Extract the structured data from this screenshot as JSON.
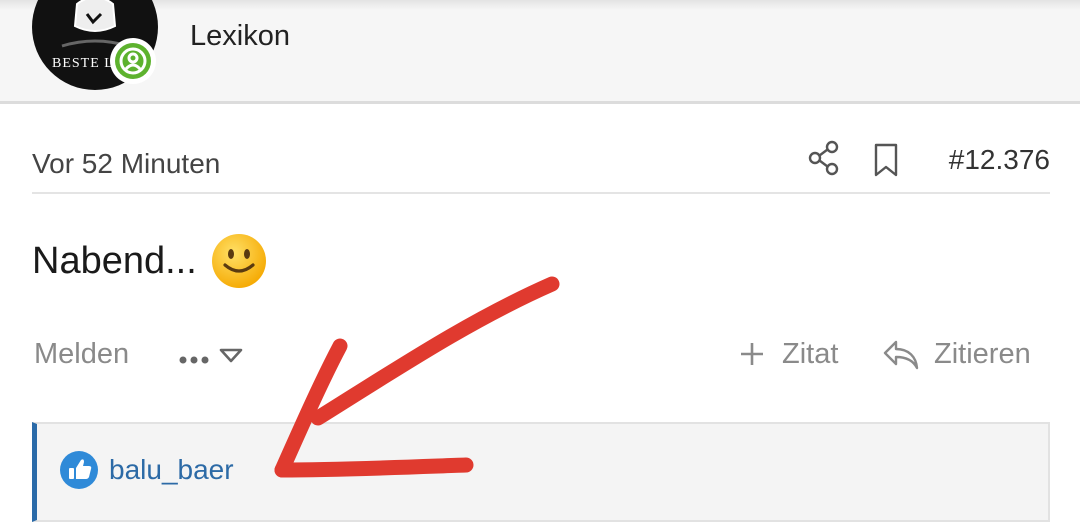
{
  "header": {
    "avatar_caption": "BESTE L",
    "section_label": "Lexikon"
  },
  "post": {
    "time": "Vor 52 Minuten",
    "post_number": "#12.376",
    "text": "Nabend...",
    "emoji": "slightly-smiling-face"
  },
  "actions": {
    "report_label": "Melden",
    "quote_label": "Zitat",
    "reply_label": "Zitieren"
  },
  "reactions": {
    "icon": "thumbs-up-icon",
    "user": "balu_baer"
  },
  "colors": {
    "online": "#5db22e",
    "link": "#2c6aa6",
    "annotation": "#e03a2f",
    "muted": "#8a8a8a"
  }
}
